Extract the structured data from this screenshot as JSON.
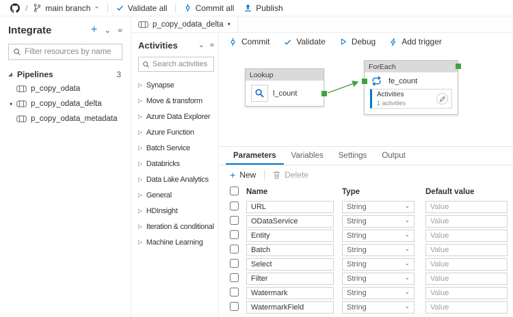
{
  "topbar": {
    "branch": "main branch",
    "validate_all": "Validate all",
    "commit_all": "Commit all",
    "publish": "Publish"
  },
  "sidebar": {
    "title": "Integrate",
    "filter_placeholder": "Filter resources by name",
    "pipelines_label": "Pipelines",
    "pipelines_count": "3",
    "items": [
      {
        "label": "p_copy_odata",
        "selected": false
      },
      {
        "label": "p_copy_odata_delta",
        "selected": true
      },
      {
        "label": "p_copy_odata_metadata",
        "selected": false
      }
    ]
  },
  "tab": {
    "label": "p_copy_odata_delta"
  },
  "activities": {
    "title": "Activities",
    "search_placeholder": "Search activities",
    "categories": [
      "Synapse",
      "Move & transform",
      "Azure Data Explorer",
      "Azure Function",
      "Batch Service",
      "Databricks",
      "Data Lake Analytics",
      "General",
      "HDInsight",
      "Iteration & conditionals",
      "Machine Learning"
    ]
  },
  "canvas": {
    "toolbar": {
      "commit": "Commit",
      "validate": "Validate",
      "debug": "Debug",
      "add_trigger": "Add trigger"
    },
    "nodes": {
      "lookup": {
        "type": "Lookup",
        "name": "l_count"
      },
      "foreach": {
        "type": "ForEach",
        "name": "fe_count",
        "inner_title": "Activities",
        "inner_subtitle": "1 activities"
      }
    }
  },
  "panel": {
    "tabs": [
      "Parameters",
      "Variables",
      "Settings",
      "Output"
    ],
    "active_tab": "Parameters",
    "new_label": "New",
    "delete_label": "Delete",
    "columns": [
      "Name",
      "Type",
      "Default value"
    ],
    "type_value": "String",
    "default_placeholder": "Value",
    "rows": [
      "URL",
      "ODataService",
      "Entity",
      "Batch",
      "Select",
      "Filter",
      "Watermark",
      "WatermarkField"
    ]
  },
  "colors": {
    "accent": "#0078d4",
    "connector_green": "#3fa23f"
  }
}
